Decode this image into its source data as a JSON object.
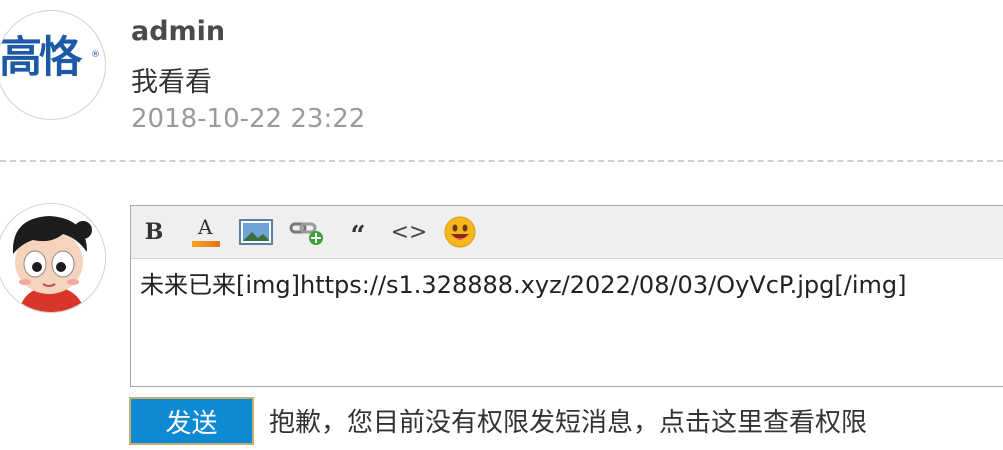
{
  "comment": {
    "username": "admin",
    "text": "我看看",
    "timestamp": "2018-10-22 23:22",
    "avatar_logo_text": "高恪",
    "avatar_logo_mark": "®"
  },
  "editor": {
    "toolbar": [
      {
        "name": "bold-button",
        "icon": "bold-icon",
        "label": "B"
      },
      {
        "name": "font-color-button",
        "icon": "font-color-icon",
        "label": "A"
      },
      {
        "name": "insert-image-button",
        "icon": "image-icon"
      },
      {
        "name": "insert-link-button",
        "icon": "link-add-icon"
      },
      {
        "name": "quote-button",
        "icon": "quote-icon",
        "label": "“"
      },
      {
        "name": "code-button",
        "icon": "code-icon",
        "label": "<>"
      },
      {
        "name": "emoji-button",
        "icon": "smiley-icon"
      }
    ],
    "content": "未来已来[img]https://s1.328888.xyz/2022/08/03/OyVcP.jpg[/img]"
  },
  "actions": {
    "send_label": "发送",
    "notice_prefix": "抱歉，您目前没有权限发短消息，",
    "notice_link": "点击这里查看权限"
  },
  "colors": {
    "send_button": "#0e89d3",
    "logo_blue": "#1d5aa6",
    "timestamp_gray": "#9a9a9a"
  }
}
